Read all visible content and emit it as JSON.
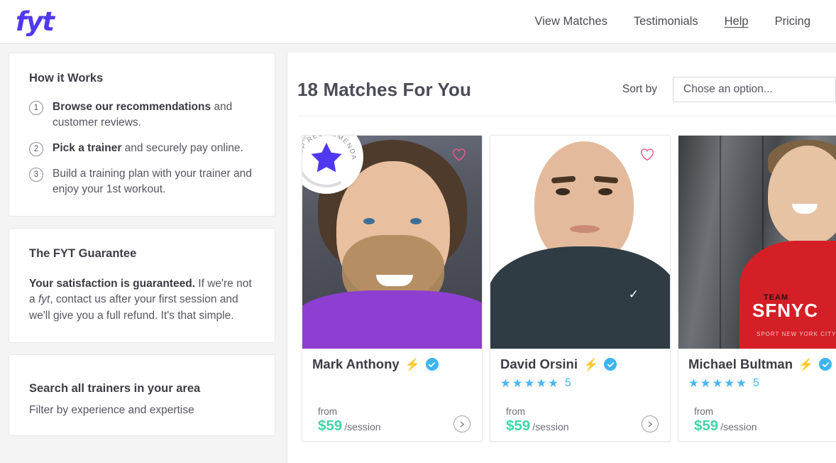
{
  "header": {
    "logo_text": "fyt",
    "logo_color": "#5038f0",
    "nav": [
      {
        "label": "View Matches",
        "underlined": false
      },
      {
        "label": "Testimonials",
        "underlined": false
      },
      {
        "label": "Help",
        "underlined": true
      },
      {
        "label": "Pricing",
        "underlined": false
      }
    ]
  },
  "sidebar": {
    "how_it_works": {
      "title": "How it Works",
      "steps": [
        {
          "num": "1",
          "bold": "Browse our recommendations",
          "rest": " and customer reviews."
        },
        {
          "num": "2",
          "bold": "Pick a trainer",
          "rest": " and securely pay online."
        },
        {
          "num": "3",
          "bold": "",
          "rest": "Build a training plan with your trainer and enjoy your 1st workout."
        }
      ]
    },
    "guarantee": {
      "title": "The FYT Guarantee",
      "bold": "Your satisfaction is guaranteed.",
      "text_part1": " If we're not a ",
      "italic": "fyt",
      "text_part2": ", contact us after your first session and we'll give you a full refund. It's that simple."
    },
    "search": {
      "title": "Search all trainers in your area",
      "subtitle": "Filter by experience and expertise"
    }
  },
  "main": {
    "title": "18 Matches For You",
    "sort_label": "Sort by",
    "sort_value": "Chose an option...",
    "top_badge_text": "TOP RECOMMENDATION",
    "colors": {
      "accent_purple": "#5038f0",
      "price_green": "#3fd6a8",
      "star_blue": "#4ab5f2",
      "heart_pink": "#f0588f"
    },
    "trainers": [
      {
        "name": "Mark Anthony",
        "bolt": "⚡",
        "verified": true,
        "rating": null,
        "stars": null,
        "from_label": "from",
        "price": "$59",
        "per": "/session",
        "top_recommendation": true,
        "favorited": false
      },
      {
        "name": "David Orsini",
        "bolt": "⚡",
        "verified": true,
        "rating": "5",
        "stars": "★★★★★",
        "from_label": "from",
        "price": "$59",
        "per": "/session",
        "top_recommendation": false,
        "favorited": false
      },
      {
        "name": "Michael Bultman",
        "bolt": "⚡",
        "verified": true,
        "rating": "5",
        "stars": "★★★★★",
        "from_label": "from",
        "price": "$59",
        "per": "/session",
        "top_recommendation": false,
        "favorited": false,
        "shirt_text_top": "TEAM",
        "shirt_text_main": "SFNYC",
        "shirt_text_sub": "SPORT NEW YORK CITY"
      }
    ]
  }
}
